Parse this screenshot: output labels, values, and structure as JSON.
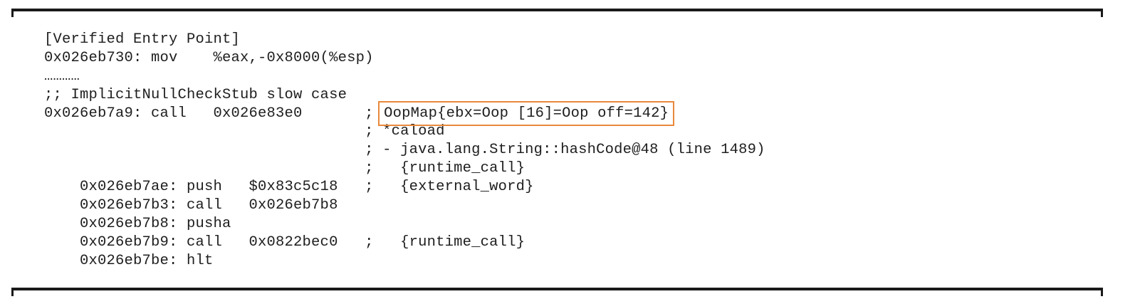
{
  "lines": [
    "[Verified Entry Point]",
    "0x026eb730: mov    %eax,-0x8000(%esp)",
    "…………",
    ";; ImplicitNullCheckStub slow case",
    "0x026eb7a9: call   0x026e83e0       ; ",
    "                                    ; *caload",
    "                                    ; - java.lang.String::hashCode@48 (line 1489)",
    "                                    ;   {runtime_call}",
    "    0x026eb7ae: push   $0x83c5c18   ;   {external_word}",
    "    0x026eb7b3: call   0x026eb7b8",
    "    0x026eb7b8: pusha",
    "    0x026eb7b9: call   0x0822bec0   ;   {runtime_call}",
    "    0x026eb7be: hlt"
  ],
  "highlight": "OopMap{ebx=Oop [16]=Oop off=142}",
  "colors": {
    "text": "#1e1e1e",
    "highlight_border": "#e8893b",
    "rule": "#1a1a1a"
  }
}
